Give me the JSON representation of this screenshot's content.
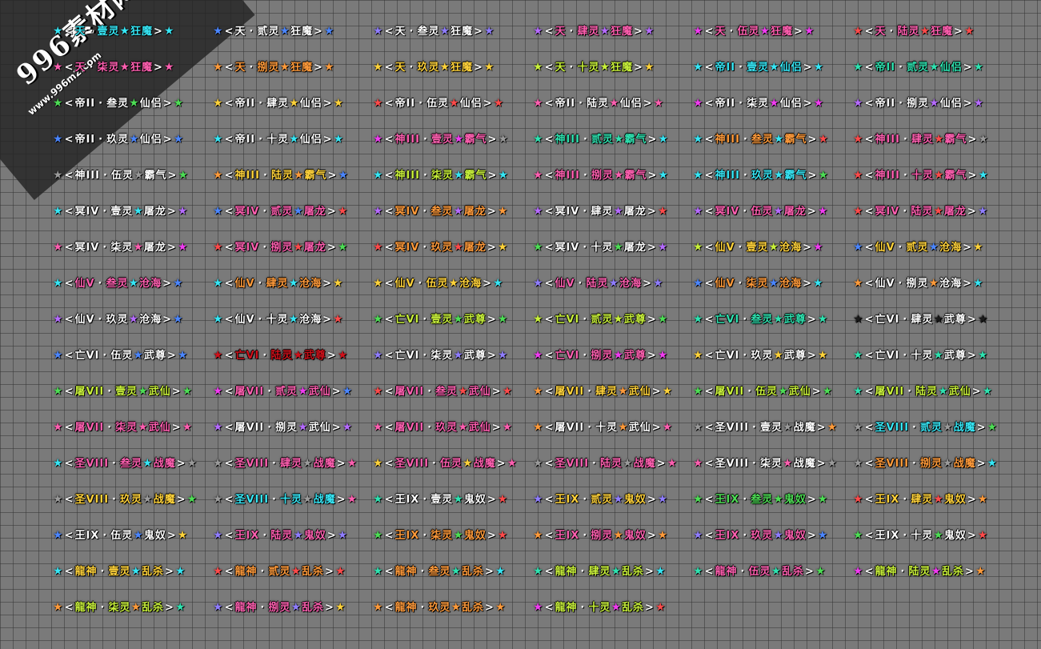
{
  "watermark": {
    "text": "996素材网",
    "url": "www.996m2.com"
  },
  "colors": {
    "blue": "#4b86ff",
    "cyan": "#36e6f5",
    "pink": "#ff5fb0",
    "red": "#ff4a4a",
    "orange": "#ff9a3a",
    "yellow": "#ffd23a",
    "green": "#4ddd55",
    "teal": "#2ee2b0",
    "purple": "#b56bff",
    "violet": "#8f7dff",
    "magenta": "#f03cf0",
    "lime": "#c8f03a",
    "white": "#ffffff",
    "gray": "#9a9a9a",
    "black": "#1a1a1a",
    "darkred": "#d0101a"
  },
  "titles": [
    {
      "tier": "天",
      "grade": "壹灵",
      "suffix": "狂魔",
      "sl": "cyan",
      "sr": "cyan",
      "tc": "cyan"
    },
    {
      "tier": "天",
      "grade": "贰灵",
      "suffix": "狂魔",
      "sl": "blue",
      "sr": "blue",
      "tc": "white"
    },
    {
      "tier": "天",
      "grade": "叁灵",
      "suffix": "狂魔",
      "sl": "violet",
      "sr": "violet",
      "tc": "white"
    },
    {
      "tier": "天",
      "grade": "肆灵",
      "suffix": "狂魔",
      "sl": "purple",
      "sr": "purple",
      "tc": "pink"
    },
    {
      "tier": "天",
      "grade": "伍灵",
      "suffix": "狂魔",
      "sl": "magenta",
      "sr": "magenta",
      "tc": "pink"
    },
    {
      "tier": "天",
      "grade": "陆灵",
      "suffix": "狂魔",
      "sl": "red",
      "sr": "red",
      "tc": "pink"
    },
    {
      "tier": "天",
      "grade": "柒灵",
      "suffix": "狂魔",
      "sl": "pink",
      "sr": "pink",
      "tc": "pink"
    },
    {
      "tier": "天",
      "grade": "捌灵",
      "suffix": "狂魔",
      "sl": "orange",
      "sr": "orange",
      "tc": "orange"
    },
    {
      "tier": "天",
      "grade": "玖灵",
      "suffix": "狂魔",
      "sl": "yellow",
      "sr": "yellow",
      "tc": "yellow"
    },
    {
      "tier": "天",
      "grade": "十灵",
      "suffix": "狂魔",
      "sl": "lime",
      "sr": "yellow",
      "tc": "lime"
    },
    {
      "tier": "帝II",
      "grade": "壹灵",
      "suffix": "仙侣",
      "sl": "cyan",
      "sr": "cyan",
      "tc": "cyan"
    },
    {
      "tier": "帝II",
      "grade": "贰灵",
      "suffix": "仙侣",
      "sl": "teal",
      "sr": "teal",
      "tc": "teal"
    },
    {
      "tier": "帝II",
      "grade": "叁灵",
      "suffix": "仙侣",
      "sl": "green",
      "sr": "green",
      "tc": "white"
    },
    {
      "tier": "帝II",
      "grade": "肆灵",
      "suffix": "仙侣",
      "sl": "yellow",
      "sr": "yellow",
      "tc": "white"
    },
    {
      "tier": "帝II",
      "grade": "伍灵",
      "suffix": "仙侣",
      "sl": "red",
      "sr": "red",
      "tc": "white"
    },
    {
      "tier": "帝II",
      "grade": "陆灵",
      "suffix": "仙侣",
      "sl": "pink",
      "sr": "pink",
      "tc": "white"
    },
    {
      "tier": "帝II",
      "grade": "柒灵",
      "suffix": "仙侣",
      "sl": "magenta",
      "sr": "magenta",
      "tc": "white"
    },
    {
      "tier": "帝II",
      "grade": "捌灵",
      "suffix": "仙侣",
      "sl": "purple",
      "sr": "purple",
      "tc": "white"
    },
    {
      "tier": "帝II",
      "grade": "玖灵",
      "suffix": "仙侣",
      "sl": "blue",
      "sr": "blue",
      "tc": "white"
    },
    {
      "tier": "帝II",
      "grade": "十灵",
      "suffix": "仙侣",
      "sl": "cyan",
      "sr": "cyan",
      "tc": "white"
    },
    {
      "tier": "神III",
      "grade": "壹灵",
      "suffix": "霸气",
      "sl": "magenta",
      "sr": "gray",
      "tc": "pink"
    },
    {
      "tier": "神III",
      "grade": "贰灵",
      "suffix": "霸气",
      "sl": "teal",
      "sr": "cyan",
      "tc": "teal"
    },
    {
      "tier": "神III",
      "grade": "叁灵",
      "suffix": "霸气",
      "sl": "cyan",
      "sr": "red",
      "tc": "orange"
    },
    {
      "tier": "神III",
      "grade": "肆灵",
      "suffix": "霸气",
      "sl": "red",
      "sr": "gray",
      "tc": "pink"
    },
    {
      "tier": "神III",
      "grade": "伍灵",
      "suffix": "霸气",
      "sl": "gray",
      "sr": "green",
      "tc": "white"
    },
    {
      "tier": "神III",
      "grade": "陆灵",
      "suffix": "霸气",
      "sl": "orange",
      "sr": "blue",
      "tc": "yellow"
    },
    {
      "tier": "神III",
      "grade": "柒灵",
      "suffix": "霸气",
      "sl": "cyan",
      "sr": "cyan",
      "tc": "lime"
    },
    {
      "tier": "神III",
      "grade": "捌灵",
      "suffix": "霸气",
      "sl": "pink",
      "sr": "cyan",
      "tc": "pink"
    },
    {
      "tier": "神III",
      "grade": "玖灵",
      "suffix": "霸气",
      "sl": "cyan",
      "sr": "green",
      "tc": "cyan"
    },
    {
      "tier": "神III",
      "grade": "十灵",
      "suffix": "霸气",
      "sl": "red",
      "sr": "cyan",
      "tc": "pink"
    },
    {
      "tier": "冥IV",
      "grade": "壹灵",
      "suffix": "屠龙",
      "sl": "cyan",
      "sr": "purple",
      "tc": "white"
    },
    {
      "tier": "冥IV",
      "grade": "贰灵",
      "suffix": "屠龙",
      "sl": "blue",
      "sr": "red",
      "tc": "pink"
    },
    {
      "tier": "冥IV",
      "grade": "叁灵",
      "suffix": "屠龙",
      "sl": "purple",
      "sr": "orange",
      "tc": "orange"
    },
    {
      "tier": "冥IV",
      "grade": "肆灵",
      "suffix": "屠龙",
      "sl": "purple",
      "sr": "red",
      "tc": "white"
    },
    {
      "tier": "冥IV",
      "grade": "伍灵",
      "suffix": "屠龙",
      "sl": "purple",
      "sr": "magenta",
      "tc": "pink"
    },
    {
      "tier": "冥IV",
      "grade": "陆灵",
      "suffix": "屠龙",
      "sl": "red",
      "sr": "violet",
      "tc": "pink"
    },
    {
      "tier": "冥IV",
      "grade": "柒灵",
      "suffix": "屠龙",
      "sl": "pink",
      "sr": "magenta",
      "tc": "white"
    },
    {
      "tier": "冥IV",
      "grade": "捌灵",
      "suffix": "屠龙",
      "sl": "red",
      "sr": "green",
      "tc": "pink"
    },
    {
      "tier": "冥IV",
      "grade": "玖灵",
      "suffix": "屠龙",
      "sl": "red",
      "sr": "yellow",
      "tc": "orange"
    },
    {
      "tier": "冥IV",
      "grade": "十灵",
      "suffix": "屠龙",
      "sl": "green",
      "sr": "purple",
      "tc": "white"
    },
    {
      "tier": "仙V",
      "grade": "壹灵",
      "suffix": "沧海",
      "sl": "lime",
      "sr": "magenta",
      "tc": "yellow"
    },
    {
      "tier": "仙V",
      "grade": "贰灵",
      "suffix": "沧海",
      "sl": "blue",
      "sr": "yellow",
      "tc": "yellow"
    },
    {
      "tier": "仙V",
      "grade": "叁灵",
      "suffix": "沧海",
      "sl": "cyan",
      "sr": "blue",
      "tc": "pink"
    },
    {
      "tier": "仙V",
      "grade": "肆灵",
      "suffix": "沧海",
      "sl": "cyan",
      "sr": "yellow",
      "tc": "orange"
    },
    {
      "tier": "仙V",
      "grade": "伍灵",
      "suffix": "沧海",
      "sl": "yellow",
      "sr": "cyan",
      "tc": "yellow"
    },
    {
      "tier": "仙V",
      "grade": "陆灵",
      "suffix": "沧海",
      "sl": "violet",
      "sr": "violet",
      "tc": "pink"
    },
    {
      "tier": "仙V",
      "grade": "柒灵",
      "suffix": "沧海",
      "sl": "blue",
      "sr": "cyan",
      "tc": "orange"
    },
    {
      "tier": "仙V",
      "grade": "捌灵",
      "suffix": "沧海",
      "sl": "orange",
      "sr": "cyan",
      "tc": "white"
    },
    {
      "tier": "仙V",
      "grade": "玖灵",
      "suffix": "沧海",
      "sl": "purple",
      "sr": "blue",
      "tc": "white"
    },
    {
      "tier": "仙V",
      "grade": "十灵",
      "suffix": "沧海",
      "sl": "cyan",
      "sr": "red",
      "tc": "white"
    },
    {
      "tier": "亡VI",
      "grade": "壹灵",
      "suffix": "武尊",
      "sl": "green",
      "sr": "green",
      "tc": "lime"
    },
    {
      "tier": "亡VI",
      "grade": "贰灵",
      "suffix": "武尊",
      "sl": "lime",
      "sr": "green",
      "tc": "lime"
    },
    {
      "tier": "亡VI",
      "grade": "叁灵",
      "suffix": "武尊",
      "sl": "teal",
      "sr": "teal",
      "tc": "teal"
    },
    {
      "tier": "亡VI",
      "grade": "肆灵",
      "suffix": "武尊",
      "sl": "black",
      "sr": "black",
      "tc": "white"
    },
    {
      "tier": "亡VI",
      "grade": "伍灵",
      "suffix": "武尊",
      "sl": "blue",
      "sr": "blue",
      "tc": "white"
    },
    {
      "tier": "亡VI",
      "grade": "陆灵",
      "suffix": "武尊",
      "sl": "darkred",
      "sr": "darkred",
      "tc": "darkred"
    },
    {
      "tier": "亡VI",
      "grade": "柒灵",
      "suffix": "武尊",
      "sl": "violet",
      "sr": "violet",
      "tc": "white"
    },
    {
      "tier": "亡VI",
      "grade": "捌灵",
      "suffix": "武尊",
      "sl": "magenta",
      "sr": "magenta",
      "tc": "pink"
    },
    {
      "tier": "亡VI",
      "grade": "玖灵",
      "suffix": "武尊",
      "sl": "yellow",
      "sr": "yellow",
      "tc": "white"
    },
    {
      "tier": "亡VI",
      "grade": "十灵",
      "suffix": "武尊",
      "sl": "teal",
      "sr": "teal",
      "tc": "white"
    },
    {
      "tier": "屠VII",
      "grade": "壹灵",
      "suffix": "武仙",
      "sl": "green",
      "sr": "green",
      "tc": "lime"
    },
    {
      "tier": "屠VII",
      "grade": "贰灵",
      "suffix": "武仙",
      "sl": "magenta",
      "sr": "blue",
      "tc": "pink"
    },
    {
      "tier": "屠VII",
      "grade": "叁灵",
      "suffix": "武仙",
      "sl": "red",
      "sr": "red",
      "tc": "pink"
    },
    {
      "tier": "屠VII",
      "grade": "肆灵",
      "suffix": "武仙",
      "sl": "orange",
      "sr": "yellow",
      "tc": "yellow"
    },
    {
      "tier": "屠VII",
      "grade": "伍灵",
      "suffix": "武仙",
      "sl": "green",
      "sr": "green",
      "tc": "lime"
    },
    {
      "tier": "屠VII",
      "grade": "陆灵",
      "suffix": "武仙",
      "sl": "teal",
      "sr": "teal",
      "tc": "lime"
    },
    {
      "tier": "屠VII",
      "grade": "柒灵",
      "suffix": "武仙",
      "sl": "pink",
      "sr": "pink",
      "tc": "pink"
    },
    {
      "tier": "屠VII",
      "grade": "捌灵",
      "suffix": "武仙",
      "sl": "purple",
      "sr": "purple",
      "tc": "white"
    },
    {
      "tier": "屠VII",
      "grade": "玖灵",
      "suffix": "武仙",
      "sl": "pink",
      "sr": "pink",
      "tc": "pink"
    },
    {
      "tier": "屠VII",
      "grade": "十灵",
      "suffix": "武仙",
      "sl": "orange",
      "sr": "pink",
      "tc": "white"
    },
    {
      "tier": "圣VIII",
      "grade": "壹灵",
      "suffix": "战魔",
      "sl": "gray",
      "sr": "orange",
      "tc": "white"
    },
    {
      "tier": "圣VIII",
      "grade": "贰灵",
      "suffix": "战魔",
      "sl": "gray",
      "sr": "green",
      "tc": "cyan"
    },
    {
      "tier": "圣VIII",
      "grade": "叁灵",
      "suffix": "战魔",
      "sl": "cyan",
      "sr": "gray",
      "tc": "pink"
    },
    {
      "tier": "圣VIII",
      "grade": "肆灵",
      "suffix": "战魔",
      "sl": "gray",
      "sr": "pink",
      "tc": "pink"
    },
    {
      "tier": "圣VIII",
      "grade": "伍灵",
      "suffix": "战魔",
      "sl": "yellow",
      "sr": "pink",
      "tc": "pink"
    },
    {
      "tier": "圣VIII",
      "grade": "陆灵",
      "suffix": "战魔",
      "sl": "gray",
      "sr": "pink",
      "tc": "pink"
    },
    {
      "tier": "圣VIII",
      "grade": "柒灵",
      "suffix": "战魔",
      "sl": "pink",
      "sr": "gray",
      "tc": "white"
    },
    {
      "tier": "圣VIII",
      "grade": "捌灵",
      "suffix": "战魔",
      "sl": "gray",
      "sr": "cyan",
      "tc": "orange"
    },
    {
      "tier": "圣VIII",
      "grade": "玖灵",
      "suffix": "战魔",
      "sl": "gray",
      "sr": "green",
      "tc": "yellow"
    },
    {
      "tier": "圣VIII",
      "grade": "十灵",
      "suffix": "战魔",
      "sl": "gray",
      "sr": "pink",
      "tc": "cyan"
    },
    {
      "tier": "王IX",
      "grade": "壹灵",
      "suffix": "鬼奴",
      "sl": "teal",
      "sr": "red",
      "tc": "white"
    },
    {
      "tier": "王IX",
      "grade": "贰灵",
      "suffix": "鬼奴",
      "sl": "violet",
      "sr": "violet",
      "tc": "yellow"
    },
    {
      "tier": "王IX",
      "grade": "叁灵",
      "suffix": "鬼奴",
      "sl": "green",
      "sr": "green",
      "tc": "green"
    },
    {
      "tier": "王IX",
      "grade": "肆灵",
      "suffix": "鬼奴",
      "sl": "red",
      "sr": "orange",
      "tc": "yellow"
    },
    {
      "tier": "王IX",
      "grade": "伍灵",
      "suffix": "鬼奴",
      "sl": "blue",
      "sr": "yellow",
      "tc": "white"
    },
    {
      "tier": "王IX",
      "grade": "陆灵",
      "suffix": "鬼奴",
      "sl": "violet",
      "sr": "violet",
      "tc": "pink"
    },
    {
      "tier": "王IX",
      "grade": "柒灵",
      "suffix": "鬼奴",
      "sl": "green",
      "sr": "red",
      "tc": "orange"
    },
    {
      "tier": "王IX",
      "grade": "捌灵",
      "suffix": "鬼奴",
      "sl": "orange",
      "sr": "orange",
      "tc": "pink"
    },
    {
      "tier": "王IX",
      "grade": "玖灵",
      "suffix": "鬼奴",
      "sl": "violet",
      "sr": "blue",
      "tc": "pink"
    },
    {
      "tier": "王IX",
      "grade": "十灵",
      "suffix": "鬼奴",
      "sl": "green",
      "sr": "red",
      "tc": "white"
    },
    {
      "tier": "龍神",
      "grade": "壹灵",
      "suffix": "乱杀",
      "sl": "cyan",
      "sr": "cyan",
      "tc": "yellow"
    },
    {
      "tier": "龍神",
      "grade": "贰灵",
      "suffix": "乱杀",
      "sl": "red",
      "sr": "red",
      "tc": "orange"
    },
    {
      "tier": "龍神",
      "grade": "叁灵",
      "suffix": "乱杀",
      "sl": "teal",
      "sr": "cyan",
      "tc": "orange"
    },
    {
      "tier": "龍神",
      "grade": "肆灵",
      "suffix": "乱杀",
      "sl": "teal",
      "sr": "cyan",
      "tc": "lime"
    },
    {
      "tier": "龍神",
      "grade": "伍灵",
      "suffix": "乱杀",
      "sl": "teal",
      "sr": "green",
      "tc": "pink"
    },
    {
      "tier": "龍神",
      "grade": "陆灵",
      "suffix": "乱杀",
      "sl": "magenta",
      "sr": "orange",
      "tc": "lime"
    },
    {
      "tier": "龍神",
      "grade": "柒灵",
      "suffix": "乱杀",
      "sl": "orange",
      "sr": "teal",
      "tc": "lime"
    },
    {
      "tier": "龍神",
      "grade": "捌灵",
      "suffix": "乱杀",
      "sl": "violet",
      "sr": "yellow",
      "tc": "pink"
    },
    {
      "tier": "龍神",
      "grade": "玖灵",
      "suffix": "乱杀",
      "sl": "orange",
      "sr": "orange",
      "tc": "orange"
    },
    {
      "tier": "龍神",
      "grade": "十灵",
      "suffix": "乱杀",
      "sl": "magenta",
      "sr": "red",
      "tc": "lime"
    }
  ]
}
